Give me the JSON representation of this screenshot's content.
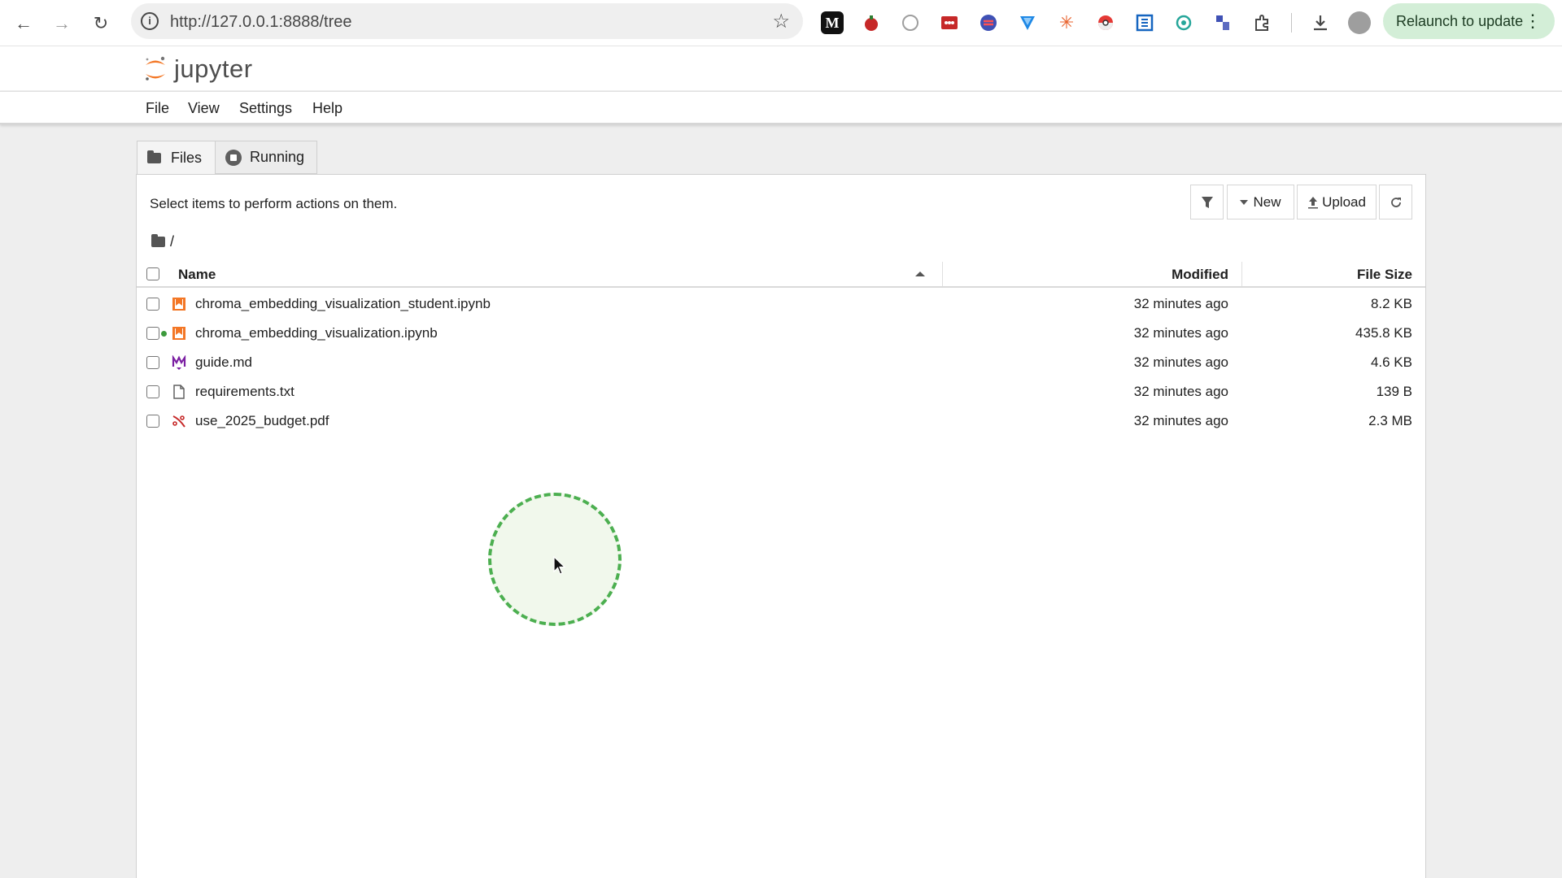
{
  "browser": {
    "url": "http://127.0.0.1:8888/tree",
    "relaunch_label": "Relaunch to update",
    "extensions": [
      "medium-icon",
      "tomato-icon",
      "shape-icon",
      "dots-icon",
      "sync-icon",
      "arrow-icon",
      "burst-icon",
      "pokeball-icon",
      "bracket-icon",
      "openai-icon",
      "puzzle-blue-icon",
      "puzzle-icon"
    ]
  },
  "app": {
    "logo_text": "jupyter"
  },
  "menu": [
    "File",
    "View",
    "Settings",
    "Help"
  ],
  "tabs": [
    {
      "label": "Files"
    },
    {
      "label": "Running"
    }
  ],
  "toolbar": {
    "hint": "Select items to perform actions on them.",
    "new_label": "New",
    "upload_label": "Upload"
  },
  "breadcrumb": "/",
  "columns": {
    "name": "Name",
    "modified": "Modified",
    "size": "File Size"
  },
  "files": [
    {
      "name": "chroma_embedding_visualization_student.ipynb",
      "modified": "32 minutes ago",
      "size": "8.2 KB",
      "type": "notebook",
      "running": false
    },
    {
      "name": "chroma_embedding_visualization.ipynb",
      "modified": "32 minutes ago",
      "size": "435.8 KB",
      "type": "notebook",
      "running": true
    },
    {
      "name": "guide.md",
      "modified": "32 minutes ago",
      "size": "4.6 KB",
      "type": "markdown",
      "running": false
    },
    {
      "name": "requirements.txt",
      "modified": "32 minutes ago",
      "size": "139 B",
      "type": "text",
      "running": false
    },
    {
      "name": "use_2025_budget.pdf",
      "modified": "32 minutes ago",
      "size": "2.3 MB",
      "type": "pdf",
      "running": false
    }
  ],
  "colors": {
    "jupyter_orange": "#F37726",
    "running_green": "#3c9a3c",
    "click_ring": "#4caf50"
  }
}
